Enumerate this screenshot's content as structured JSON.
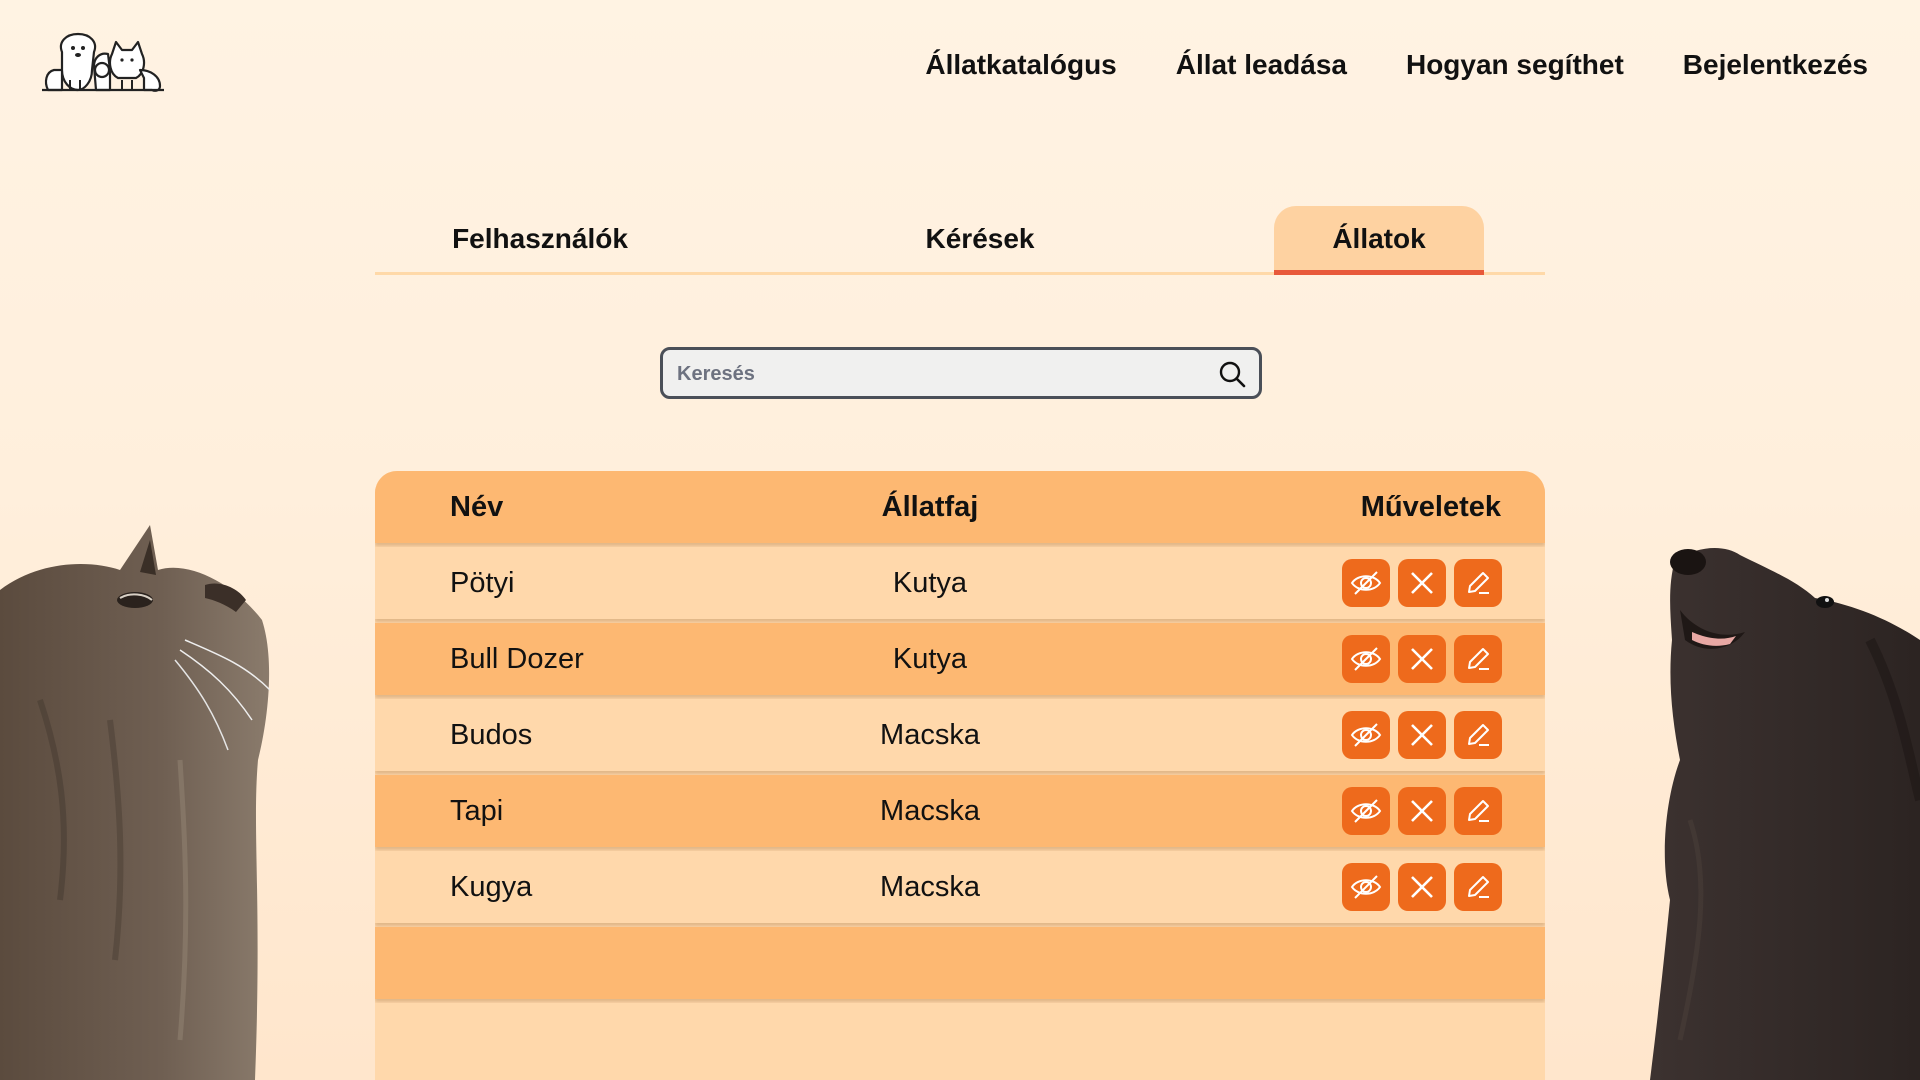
{
  "nav": {
    "items": [
      {
        "label": "Állatkatalógus",
        "name": "nav-catalog"
      },
      {
        "label": "Állat leadása",
        "name": "nav-surrender"
      },
      {
        "label": "Hogyan segíthet",
        "name": "nav-help"
      },
      {
        "label": "Bejelentkezés",
        "name": "nav-login"
      }
    ]
  },
  "tabs": {
    "users": "Felhasználók",
    "requests": "Kérések",
    "animals": "Állatok",
    "active": "animals"
  },
  "search": {
    "placeholder": "Keresés",
    "value": "",
    "icon": "search-icon"
  },
  "table": {
    "headers": {
      "name": "Név",
      "species": "Állatfaj",
      "actions": "Műveletek"
    },
    "rows": [
      {
        "name": "Pötyi",
        "species": "Kutya"
      },
      {
        "name": "Bull Dozer",
        "species": "Kutya"
      },
      {
        "name": "Budos",
        "species": "Macska"
      },
      {
        "name": "Tapi",
        "species": "Macska"
      },
      {
        "name": "Kugya",
        "species": "Macska"
      }
    ],
    "action_icons": [
      "eye-off-icon",
      "close-icon",
      "pencil-icon"
    ]
  },
  "colors": {
    "background": "#fff3e3",
    "row_light": "#ffd8ab",
    "row_dark": "#fdb872",
    "action_button": "#ee6a1c",
    "tab_active_underline": "#e8593a"
  }
}
